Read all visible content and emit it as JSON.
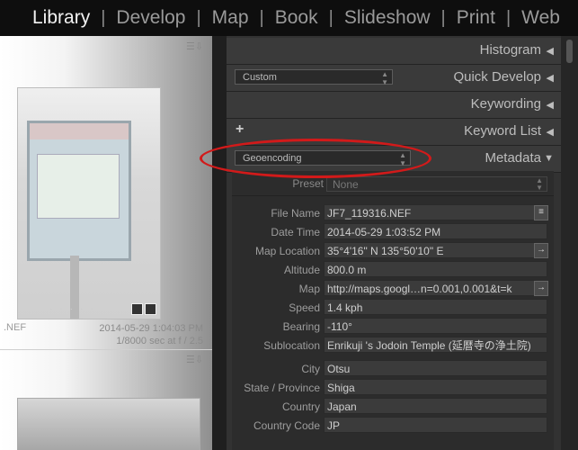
{
  "modules": [
    "Library",
    "Develop",
    "Map",
    "Book",
    "Slideshow",
    "Print",
    "Web"
  ],
  "active_module": "Library",
  "grid": {
    "date_time": "2014-05-29 1:04:03 PM",
    "exposure": "1/8000 sec at f / 2.5",
    "filename_fragment": ".NEF"
  },
  "panels": {
    "histogram": "Histogram",
    "quick_develop": {
      "title": "Quick Develop",
      "preset": "Custom"
    },
    "keywording": "Keywording",
    "keyword_list": "Keyword List",
    "metadata": {
      "title": "Metadata",
      "view": "Geoencoding"
    }
  },
  "metadata": {
    "preset_label": "Preset",
    "preset_value": "None",
    "fields": [
      {
        "label": "File Name",
        "value": "JF7_119316.NEF"
      },
      {
        "label": "Date Time",
        "value": "2014-05-29 1:03:52 PM"
      },
      {
        "label": "Map Location",
        "value": "35°4'16\" N 135°50'10\" E"
      },
      {
        "label": "Altitude",
        "value": "800.0 m"
      },
      {
        "label": "Map",
        "value": "http://maps.googl…n=0.001,0.001&t=k"
      },
      {
        "label": "Speed",
        "value": "1.4 kph"
      },
      {
        "label": "Bearing",
        "value": "-110°"
      },
      {
        "label": "Sublocation",
        "value": "Enrikuji 's Jodoin Temple (延暦寺の浄土院)"
      },
      {
        "label": "City",
        "value": "Otsu"
      },
      {
        "label": "State / Province",
        "value": "Shiga"
      },
      {
        "label": "Country",
        "value": "Japan"
      },
      {
        "label": "Country Code",
        "value": "JP"
      }
    ]
  },
  "colors": {
    "annotation": "#d21a1a",
    "panel_bg": "#323232",
    "topbar_bg": "#0e0e0e"
  }
}
